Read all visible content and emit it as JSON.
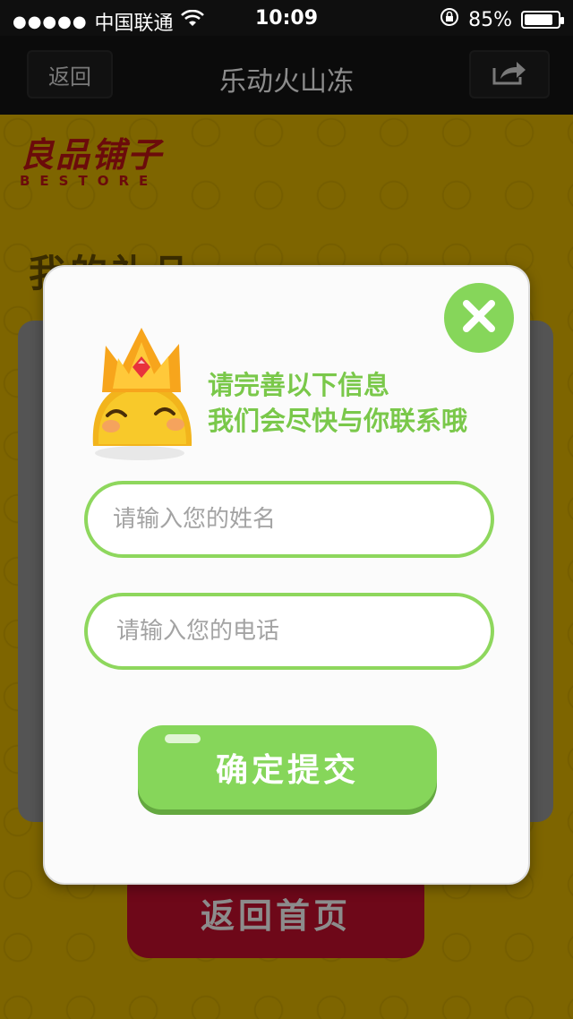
{
  "status_bar": {
    "signal": "●●●●●",
    "carrier": "中国联通",
    "time": "10:09",
    "battery": "85%",
    "battery_level": 0.85
  },
  "nav": {
    "back_label": "返回",
    "title": "乐动火山冻"
  },
  "background": {
    "brand_cn": "良品铺子",
    "brand_en": "BESTORE",
    "page_title": "我的礼品",
    "home_label": "返回首页"
  },
  "modal": {
    "headline_line1": "请完善以下信息",
    "headline_line2": "我们会尽快与你联系哦",
    "name_placeholder": "请输入您的姓名",
    "phone_placeholder": "请输入您的电话",
    "submit_label": "确定提交"
  },
  "colors": {
    "accent_green": "#86d65a",
    "background_yellow": "#e5b800",
    "brand_red": "#c31414"
  }
}
